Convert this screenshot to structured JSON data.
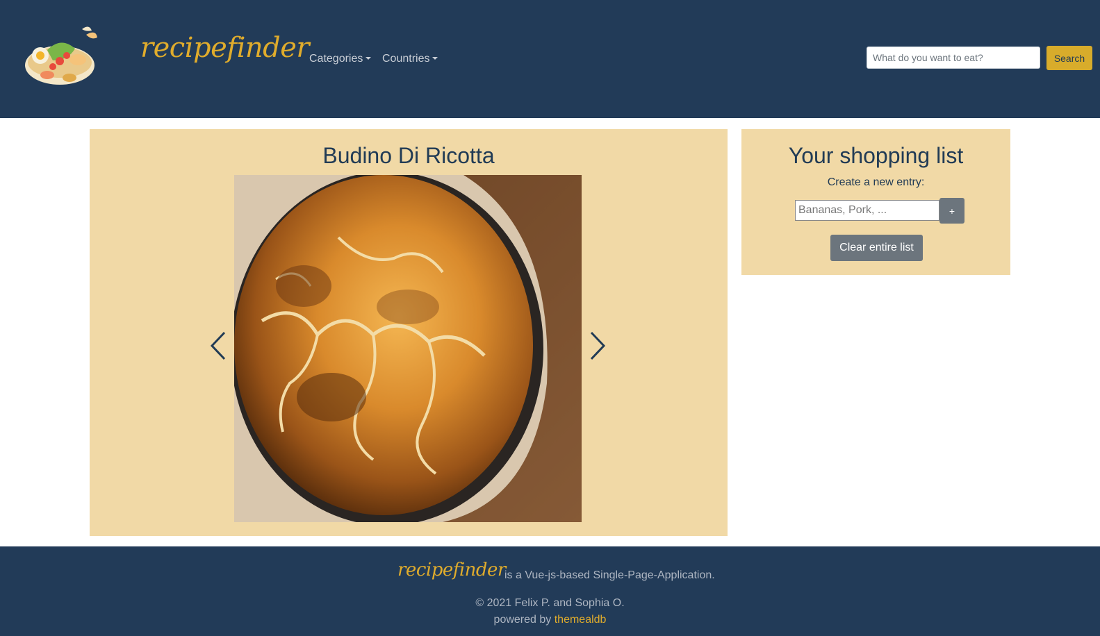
{
  "navbar": {
    "brand": "recipefinder",
    "menu": [
      {
        "label": "Categories"
      },
      {
        "label": "Countries"
      }
    ],
    "search_placeholder": "What do you want to eat?",
    "search_button": "Search"
  },
  "recipe": {
    "title": "Budino Di Ricotta"
  },
  "shopping_list": {
    "title": "Your shopping list",
    "subtitle": "Create a new entry:",
    "input_placeholder": "Bananas, Pork, ...",
    "add_button": "+",
    "clear_button": "Clear entire list"
  },
  "footer": {
    "brand": "recipefinder",
    "description": "is a Vue-js-based Single-Page-Application.",
    "copyright": "© 2021 Felix P. and Sophia O.",
    "powered_prefix": "powered by ",
    "powered_link": "themealdb"
  },
  "colors": {
    "navbar_bg": "#223b58",
    "accent": "#d8ac2b",
    "card_bg": "#f1d9a6",
    "button_secondary": "#6c757d"
  }
}
